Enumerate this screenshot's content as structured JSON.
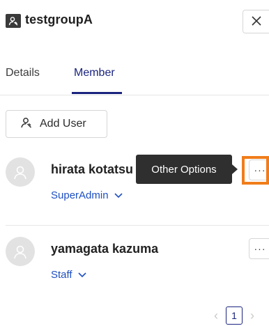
{
  "header": {
    "group_name": "testgroupA",
    "group_icon": "group-icon",
    "close_icon": "close-icon"
  },
  "tabs": [
    {
      "label": "Details",
      "active": false
    },
    {
      "label": "Member",
      "active": true
    }
  ],
  "actions": {
    "add_user_label": "Add User",
    "add_user_icon": "add-user-icon"
  },
  "members": [
    {
      "name": "hirata kotatsu",
      "role": "SuperAdmin",
      "avatar_icon": "user-icon",
      "more_icon": "ellipsis-icon"
    },
    {
      "name": "yamagata kazuma",
      "role": "Staff",
      "avatar_icon": "user-icon",
      "more_icon": "ellipsis-icon"
    }
  ],
  "tooltip": {
    "text": "Other Options"
  },
  "pagination": {
    "current_page": "1"
  },
  "colors": {
    "accent": "#1a237e",
    "link": "#1e4fc2",
    "highlight": "#f07d1a",
    "tooltip_bg": "#2f2f2f"
  }
}
